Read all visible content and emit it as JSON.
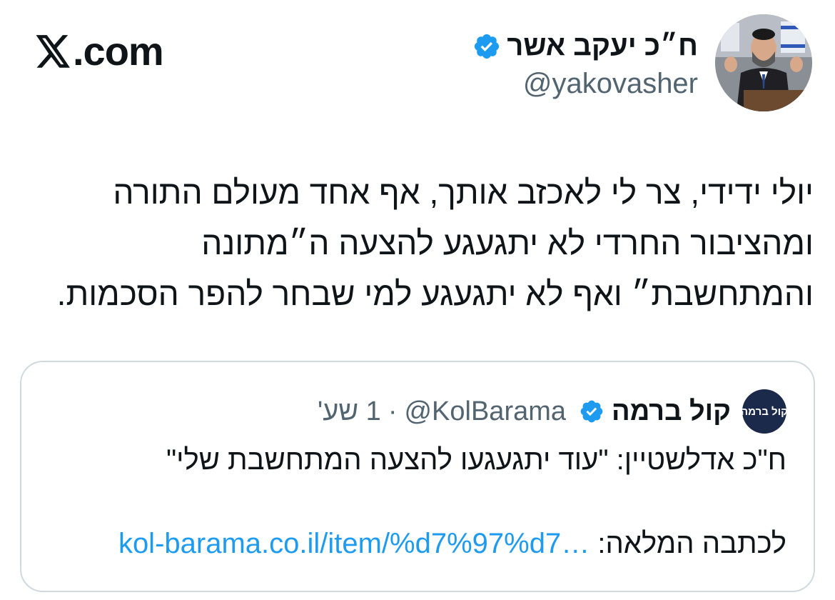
{
  "brand": {
    "logo_icon": "x-logo-icon",
    "suffix": ".com"
  },
  "author": {
    "name": "ח״כ יעקב אשר",
    "handle": "@yakovasher",
    "verified_icon": "verified-badge-icon",
    "verified_color": "#1d9bf0"
  },
  "tweet": {
    "lines": [
      "יולי ידידי, צר לי לאכזב אותך, אף אחד מעולם התורה",
      "ומהציבור החרדי לא יתגעגע להצעה ה״מתונה",
      "והמתחשבת״ ואף לא יתגעגע למי  שבחר להפר הסכמות."
    ]
  },
  "quoted_tweet": {
    "avatar_text": "קול ברמה",
    "name": "קול ברמה",
    "handle": "@KolBarama",
    "separator": "·",
    "time": "1 שע'",
    "text": "ח\"כ אדלשטיין: \"עוד יתגעגעו להצעה המתחשבת שלי\"",
    "link_label": "לכתבה המלאה:",
    "link_text": "kol-barama.co.il/item/%d7%97%d7…"
  },
  "colors": {
    "link": "#1d9bf0",
    "secondary_text": "#536471",
    "border": "#cfd9de"
  }
}
